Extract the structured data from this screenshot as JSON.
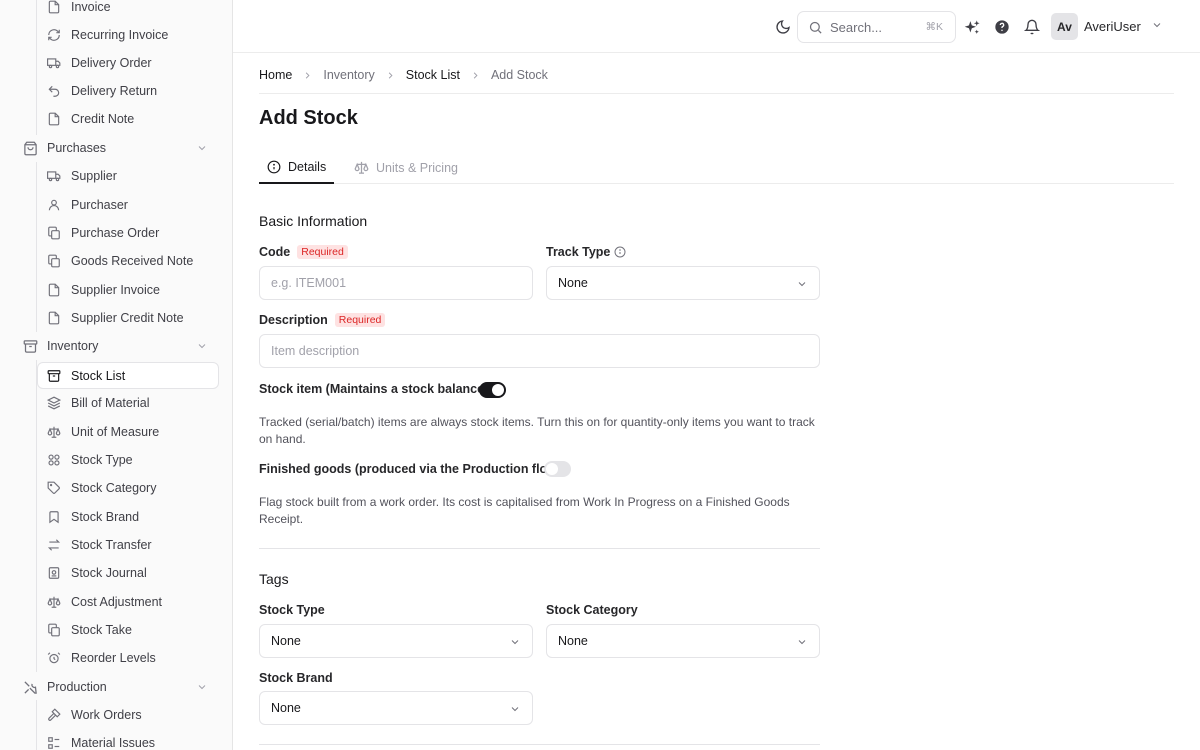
{
  "sidebar": {
    "items": [
      {
        "label": "Invoice",
        "icon": "file-icon"
      },
      {
        "label": "Recurring Invoice",
        "icon": "refresh-icon"
      },
      {
        "label": "Delivery Order",
        "icon": "truck-icon"
      },
      {
        "label": "Delivery Return",
        "icon": "undo-icon"
      },
      {
        "label": "Credit Note",
        "icon": "file-icon"
      }
    ],
    "purchases": {
      "label": "Purchases",
      "icon": "shopping-bag-icon"
    },
    "purchase_items": [
      {
        "label": "Supplier",
        "icon": "truck-icon"
      },
      {
        "label": "Purchaser",
        "icon": "user-icon"
      },
      {
        "label": "Purchase Order",
        "icon": "copy-icon"
      },
      {
        "label": "Goods Received Note",
        "icon": "copy-icon"
      },
      {
        "label": "Supplier Invoice",
        "icon": "file-icon"
      },
      {
        "label": "Supplier Credit Note",
        "icon": "file-icon"
      }
    ],
    "inventory": {
      "label": "Inventory",
      "icon": "archive-icon"
    },
    "inventory_items": [
      {
        "label": "Stock List",
        "icon": "archive-icon",
        "active": true
      },
      {
        "label": "Bill of Material",
        "icon": "layers-icon"
      },
      {
        "label": "Unit of Measure",
        "icon": "scale-icon"
      },
      {
        "label": "Stock Type",
        "icon": "grid-icon"
      },
      {
        "label": "Stock Category",
        "icon": "tag-icon"
      },
      {
        "label": "Stock Brand",
        "icon": "bookmark-icon"
      },
      {
        "label": "Stock Transfer",
        "icon": "transfer-icon"
      },
      {
        "label": "Stock Journal",
        "icon": "journal-icon"
      },
      {
        "label": "Cost Adjustment",
        "icon": "scale-icon"
      },
      {
        "label": "Stock Take",
        "icon": "copy-icon"
      },
      {
        "label": "Reorder Levels",
        "icon": "alarm-icon"
      }
    ],
    "production": {
      "label": "Production",
      "icon": "tools-icon"
    },
    "production_items": [
      {
        "label": "Work Orders",
        "icon": "hammer-icon"
      },
      {
        "label": "Material Issues",
        "icon": "list-icon"
      }
    ]
  },
  "topbar": {
    "search_placeholder": "Search...",
    "search_shortcut": "⌘K",
    "avatar_initials": "Av",
    "username": "AveriUser"
  },
  "breadcrumb": [
    "Home",
    "Inventory",
    "Stock List",
    "Add Stock"
  ],
  "page_title": "Add Stock",
  "tabs": [
    {
      "label": "Details",
      "active": true
    },
    {
      "label": "Units & Pricing",
      "active": false
    }
  ],
  "basic": {
    "title": "Basic Information",
    "code_label": "Code",
    "required_badge": "Required",
    "code_placeholder": "e.g. ITEM001",
    "track_type_label": "Track Type",
    "track_type_value": "None",
    "description_label": "Description",
    "description_placeholder": "Item description",
    "stock_item_label": "Stock item (Maintains a stock balance)",
    "stock_item_on": true,
    "stock_item_help": "Tracked (serial/batch) items are always stock items. Turn this on for quantity-only items you want to track on hand.",
    "finished_goods_label": "Finished goods (produced via the Production flow)",
    "finished_goods_on": false,
    "finished_goods_help": "Flag stock built from a work order. Its cost is capitalised from Work In Progress on a Finished Goods Receipt."
  },
  "tags": {
    "title": "Tags",
    "stock_type_label": "Stock Type",
    "stock_type_value": "None",
    "stock_category_label": "Stock Category",
    "stock_category_value": "None",
    "stock_brand_label": "Stock Brand",
    "stock_brand_value": "None"
  },
  "colors": {
    "accent": "#18181b",
    "required_text": "#dc2626",
    "required_bg": "#fee2e2"
  }
}
